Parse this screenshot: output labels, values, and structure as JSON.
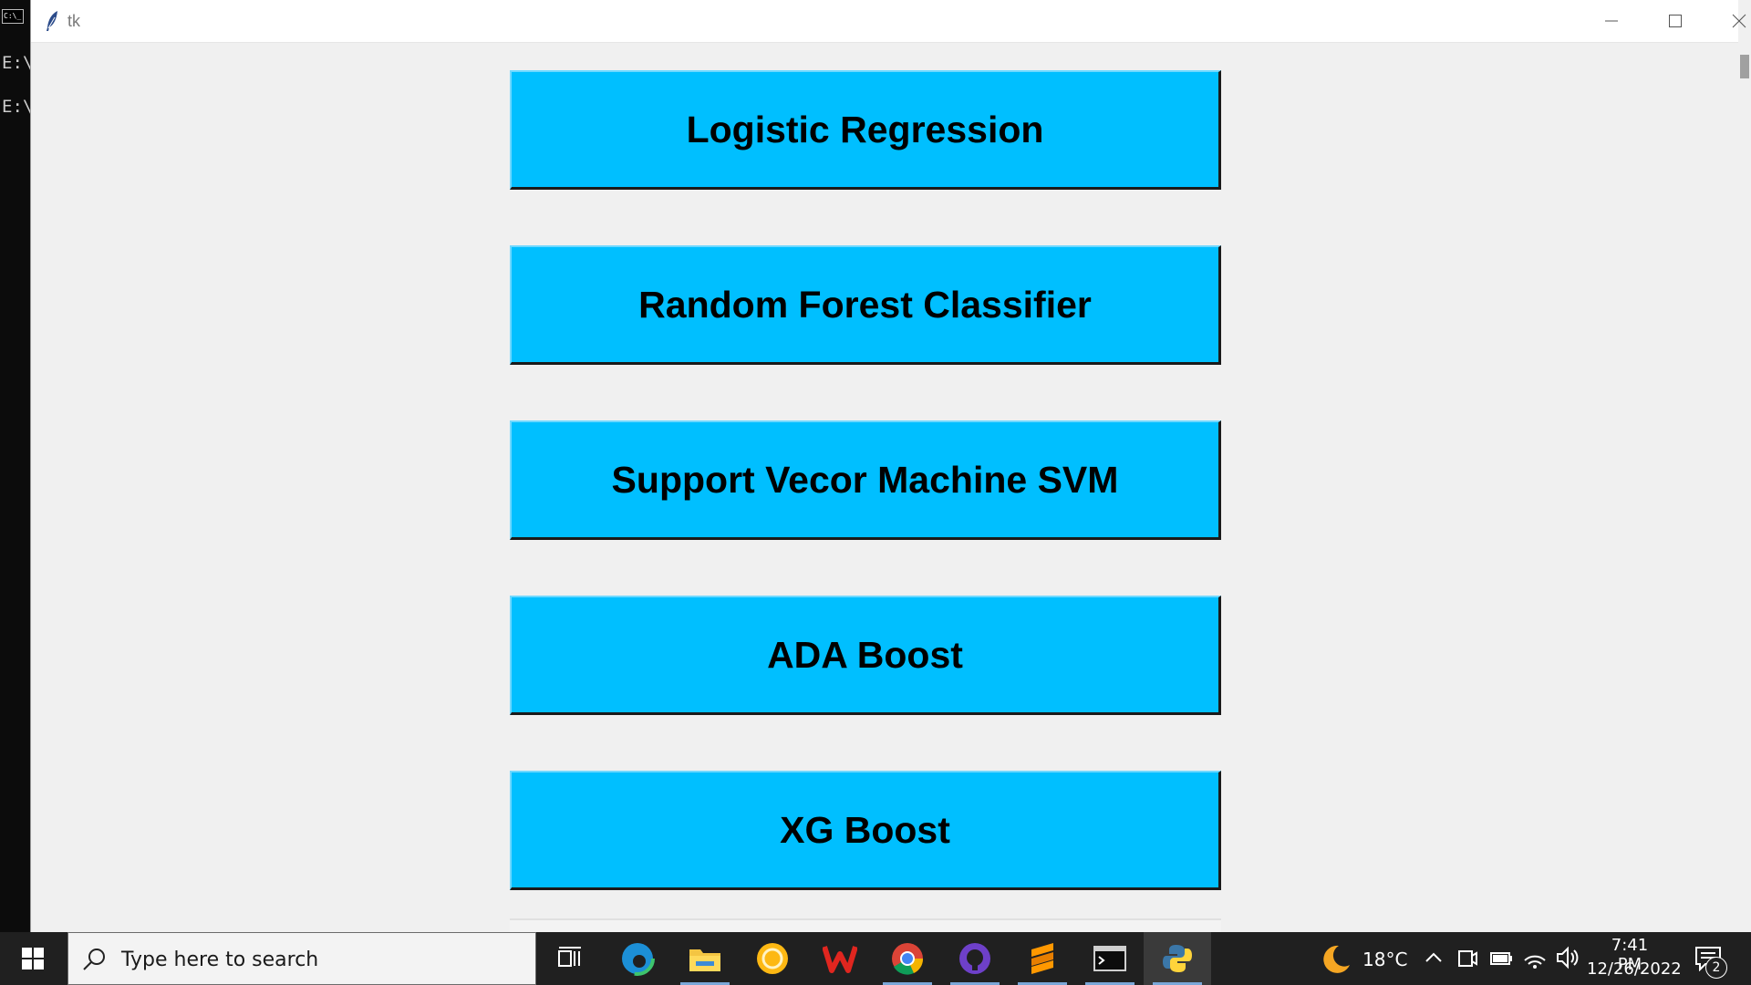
{
  "console": {
    "lines": [
      "E:\\",
      "E:\\"
    ]
  },
  "window": {
    "title": "tk"
  },
  "buttons": [
    {
      "label": "Logistic Regression"
    },
    {
      "label": "Random Forest Classifier"
    },
    {
      "label": "Support Vecor Machine SVM"
    },
    {
      "label": "ADA Boost"
    },
    {
      "label": "XG Boost"
    }
  ],
  "colors": {
    "button_bg": "#00bfff",
    "window_bg": "#f0f0f0",
    "taskbar_bg": "#202020"
  },
  "taskbar": {
    "search_placeholder": "Type here to search",
    "apps": [
      "task-view",
      "edge",
      "file-explorer",
      "norton",
      "wps-office",
      "chrome",
      "github-desktop",
      "sublime-text",
      "terminal",
      "python"
    ],
    "weather": "18°C",
    "time": "7:41 PM",
    "date": "12/26/2022",
    "notifications": "2"
  }
}
